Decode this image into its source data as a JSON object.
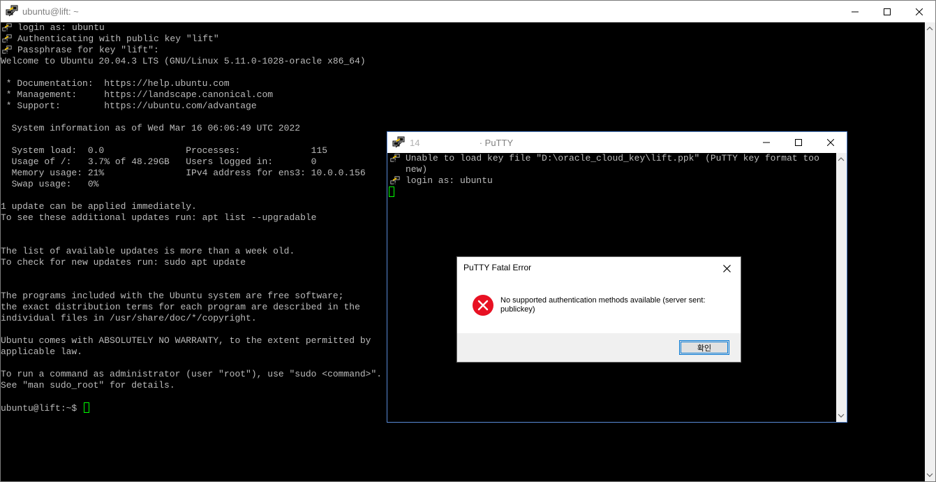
{
  "main_window": {
    "title": "ubuntu@lift: ~",
    "terminal_lines": [
      {
        "icon": true,
        "text": "login as: ubuntu"
      },
      {
        "icon": true,
        "text": "Authenticating with public key \"lift\""
      },
      {
        "icon": true,
        "text": "Passphrase for key \"lift\":"
      },
      {
        "icon": false,
        "text": "Welcome to Ubuntu 20.04.3 LTS (GNU/Linux 5.11.0-1028-oracle x86_64)"
      },
      {
        "icon": false,
        "text": ""
      },
      {
        "icon": false,
        "text": " * Documentation:  https://help.ubuntu.com"
      },
      {
        "icon": false,
        "text": " * Management:     https://landscape.canonical.com"
      },
      {
        "icon": false,
        "text": " * Support:        https://ubuntu.com/advantage"
      },
      {
        "icon": false,
        "text": ""
      },
      {
        "icon": false,
        "text": "  System information as of Wed Mar 16 06:06:49 UTC 2022"
      },
      {
        "icon": false,
        "text": ""
      },
      {
        "icon": false,
        "text": "  System load:  0.0               Processes:             115"
      },
      {
        "icon": false,
        "text": "  Usage of /:   3.7% of 48.29GB   Users logged in:       0"
      },
      {
        "icon": false,
        "text": "  Memory usage: 21%               IPv4 address for ens3: 10.0.0.156"
      },
      {
        "icon": false,
        "text": "  Swap usage:   0%"
      },
      {
        "icon": false,
        "text": ""
      },
      {
        "icon": false,
        "text": "1 update can be applied immediately."
      },
      {
        "icon": false,
        "text": "To see these additional updates run: apt list --upgradable"
      },
      {
        "icon": false,
        "text": ""
      },
      {
        "icon": false,
        "text": ""
      },
      {
        "icon": false,
        "text": "The list of available updates is more than a week old."
      },
      {
        "icon": false,
        "text": "To check for new updates run: sudo apt update"
      },
      {
        "icon": false,
        "text": ""
      },
      {
        "icon": false,
        "text": ""
      },
      {
        "icon": false,
        "text": "The programs included with the Ubuntu system are free software;"
      },
      {
        "icon": false,
        "text": "the exact distribution terms for each program are described in the"
      },
      {
        "icon": false,
        "text": "individual files in /usr/share/doc/*/copyright."
      },
      {
        "icon": false,
        "text": ""
      },
      {
        "icon": false,
        "text": "Ubuntu comes with ABSOLUTELY NO WARRANTY, to the extent permitted by"
      },
      {
        "icon": false,
        "text": "applicable law."
      },
      {
        "icon": false,
        "text": ""
      },
      {
        "icon": false,
        "text": "To run a command as administrator (user \"root\"), use \"sudo <command>\"."
      },
      {
        "icon": false,
        "text": "See \"man sudo_root\" for details."
      },
      {
        "icon": false,
        "text": ""
      }
    ],
    "prompt": "ubuntu@lift:~$ "
  },
  "second_window": {
    "title_prefix": "14",
    "title_suffix": "· PuTTY",
    "terminal_lines": [
      {
        "icon": true,
        "text": "Unable to load key file \"D:\\oracle_cloud_key\\lift.ppk\" (PuTTY key format too"
      },
      {
        "icon": false,
        "text": "new)"
      },
      {
        "icon": true,
        "text": "login as: ubuntu"
      }
    ]
  },
  "dialog": {
    "title": "PuTTY Fatal Error",
    "message": "No supported authentication methods available (server sent: publickey)",
    "ok_label": "확인",
    "icon": "error-icon"
  },
  "colors": {
    "terminal_text": "#bbbbbb",
    "cursor": "#00ff00",
    "error_red": "#e81123",
    "focus_blue": "#0078d7"
  }
}
